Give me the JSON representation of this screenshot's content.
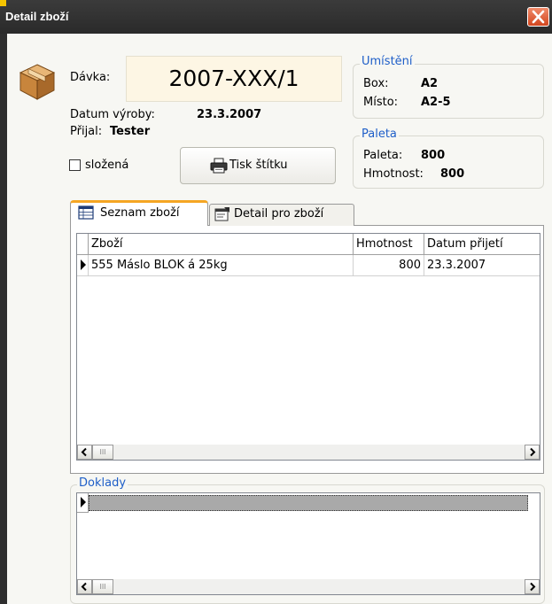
{
  "window": {
    "title": "Detail zboží",
    "close_icon": "close-icon",
    "title_accent_color": "#f5c400",
    "close_color": "#d2461e"
  },
  "header": {
    "icon": "package-box-icon",
    "davka_label": "Dávka:",
    "davka_value": "2007-XXX/1",
    "datum_label": "Datum výroby:",
    "datum_value": "23.3.2007",
    "prijal_label": "Přijal:",
    "prijal_value": "Tester",
    "slozena_label": "složená",
    "slozena_checked": false,
    "print_button_label": "Tisk štítku",
    "print_icon": "printer-icon"
  },
  "umisteni": {
    "title": "Umístění",
    "box_label": "Box:",
    "box_value": "A2",
    "misto_label": "Místo:",
    "misto_value": "A2-5"
  },
  "paleta": {
    "title": "Paleta",
    "paleta_label": "Paleta:",
    "paleta_value": "800",
    "hmotnost_label": "Hmotnost:",
    "hmotnost_value": "800"
  },
  "tabs": [
    {
      "label": "Seznam zboží",
      "icon": "table-icon",
      "active": true
    },
    {
      "label": "Detail pro zboží",
      "icon": "form-detail-icon",
      "active": false
    }
  ],
  "goods_table": {
    "columns": [
      "Zboží",
      "Hmotnost",
      "Datum přijetí"
    ],
    "rows": [
      {
        "zbozi": "555 Máslo BLOK á 25kg",
        "hmotnost": "800",
        "datum": "23.3.2007"
      }
    ],
    "scroll_thumb": "III"
  },
  "doklady": {
    "title": "Doklady",
    "scroll_thumb": "III"
  },
  "colors": {
    "accent_blue": "#1e5ec8",
    "active_tab_orange": "#f5a623",
    "davka_background": "#fdf6e4"
  }
}
